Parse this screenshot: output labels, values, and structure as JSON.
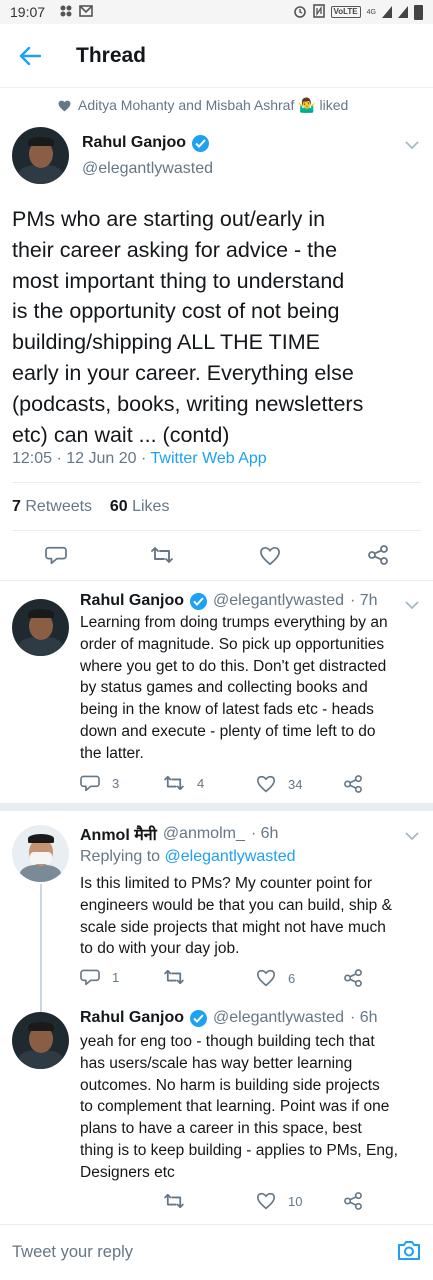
{
  "status_bar": {
    "time": "19:07",
    "lte_label": "VoLTE",
    "net_label": "4G"
  },
  "header": {
    "title": "Thread"
  },
  "liked_line": {
    "text": "Aditya Mohanty and Misbah Ashraf 🤷‍♂️ liked"
  },
  "main_tweet": {
    "name": "Rahul Ganjoo",
    "handle": "@elegantlywasted",
    "lines": [
      "PMs who are starting out/early in",
      "their career asking for advice - the",
      "most important thing to understand",
      "is the opportunity cost of not being",
      "building/shipping ALL THE TIME",
      "early in your career. Everything else",
      "(podcasts, books, writing newsletters",
      "etc) can wait ... (contd)"
    ],
    "time": "12:05",
    "date": "12 Jun 20",
    "app": "Twitter Web App",
    "retweets_count": "7",
    "retweets_label": "Retweets",
    "likes_count": "60",
    "likes_label": "Likes"
  },
  "replies": [
    {
      "name": "Rahul Ganjoo",
      "handle": "@elegantlywasted",
      "age": "· 7h",
      "lines": [
        "Learning from doing trumps everything by an",
        "order of magnitude. So pick up opportunities",
        "where you get to do this. Don't get distracted",
        "by status games and collecting books and",
        "being in the know of latest fads etc - heads",
        "down and execute - plenty of time left to do",
        "the latter."
      ],
      "reply_count": "3",
      "retweet_count": "4",
      "like_count": "34"
    },
    {
      "name": "Anmol मैनी",
      "handle": "@anmolm_",
      "age": "· 6h",
      "replying_prefix": "Replying to",
      "replying_to": "@elegantlywasted",
      "lines": [
        "Is this limited to PMs? My counter point for",
        "engineers would be that you can build, ship &",
        "scale side projects that might not have much",
        "to do with your day job."
      ],
      "reply_count": "1",
      "retweet_count": "",
      "like_count": "6"
    },
    {
      "name": "Rahul Ganjoo",
      "handle": "@elegantlywasted",
      "age": "· 6h",
      "lines": [
        "yeah for eng too - though building tech that",
        "has users/scale has way better learning",
        "outcomes. No harm is building side projects",
        "to complement that learning. Point was if one",
        "plans to have a career in this space, best",
        "thing is to keep building - applies to PMs, Eng,",
        "Designers etc"
      ],
      "reply_count": "",
      "retweet_count": "",
      "like_count": "10"
    }
  ],
  "composer": {
    "placeholder": "Tweet your reply"
  },
  "colors": {
    "accent": "#1da1f2",
    "secondary_text": "#657786",
    "divider": "#e6ecf0"
  },
  "icons": [
    "back-arrow-icon",
    "heart-icon",
    "verified-badge-icon",
    "chevron-down-icon",
    "reply-icon",
    "retweet-icon",
    "share-icon",
    "camera-icon"
  ]
}
